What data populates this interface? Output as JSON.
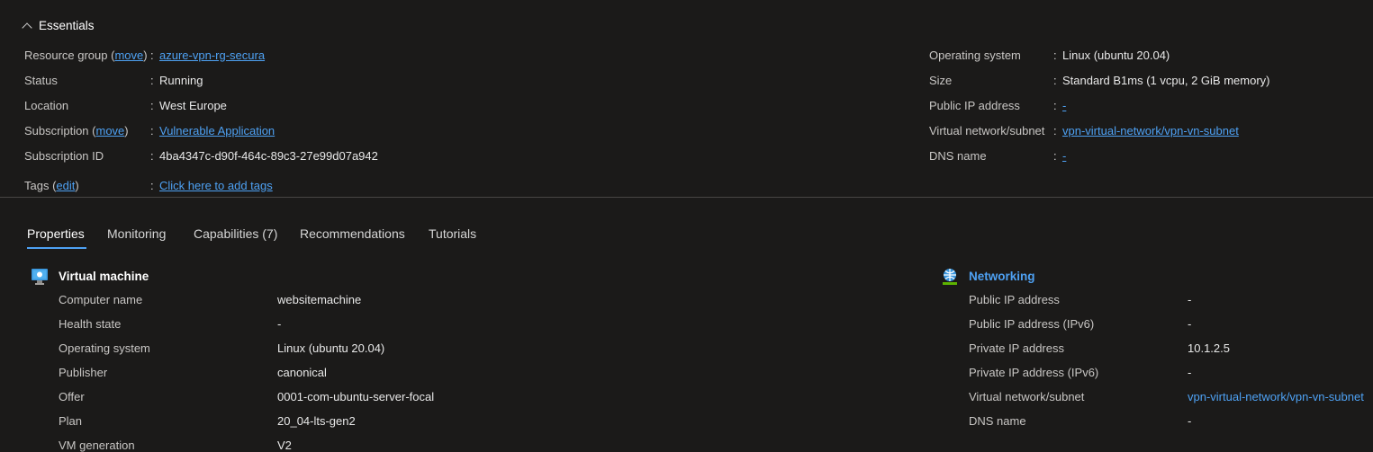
{
  "essentials": {
    "title": "Essentials",
    "left": [
      {
        "label": "Resource group",
        "action": "move",
        "value": "azure-vpn-rg-secura",
        "link": true
      },
      {
        "label": "Status",
        "value": "Running",
        "link": false
      },
      {
        "label": "Location",
        "value": "West Europe",
        "link": false
      },
      {
        "label": "Subscription",
        "action": "move",
        "value": "Vulnerable Application",
        "link": true
      },
      {
        "label": "Subscription ID",
        "value": "4ba4347c-d90f-464c-89c3-27e99d07a942",
        "link": false
      }
    ],
    "tags": {
      "label": "Tags",
      "action": "edit",
      "value": "Click here to add tags"
    },
    "right": [
      {
        "label": "Operating system",
        "value": "Linux (ubuntu 20.04)",
        "link": false
      },
      {
        "label": "Size",
        "value": "Standard B1ms (1 vcpu, 2 GiB memory)",
        "link": false
      },
      {
        "label": "Public IP address",
        "value": "-",
        "link": true
      },
      {
        "label": "Virtual network/subnet",
        "value": "vpn-virtual-network/vpn-vn-subnet",
        "link": true
      },
      {
        "label": "DNS name",
        "value": "-",
        "link": true
      }
    ]
  },
  "tabs": [
    "Properties",
    "Monitoring",
    "Capabilities (7)",
    "Recommendations",
    "Tutorials"
  ],
  "active_tab": "Properties",
  "virtual_machine": {
    "title": "Virtual machine",
    "rows": [
      {
        "label": "Computer name",
        "value": "websitemachine"
      },
      {
        "label": "Health state",
        "value": "-"
      },
      {
        "label": "Operating system",
        "value": "Linux (ubuntu 20.04)"
      },
      {
        "label": "Publisher",
        "value": "canonical"
      },
      {
        "label": "Offer",
        "value": "0001-com-ubuntu-server-focal"
      },
      {
        "label": "Plan",
        "value": "20_04-lts-gen2"
      },
      {
        "label": "VM generation",
        "value": "V2"
      }
    ]
  },
  "networking": {
    "title": "Networking",
    "rows": [
      {
        "label": "Public IP address",
        "value": "-"
      },
      {
        "label": "Public IP address (IPv6)",
        "value": "-"
      },
      {
        "label": "Private IP address",
        "value": "10.1.2.5"
      },
      {
        "label": "Private IP address (IPv6)",
        "value": "-"
      },
      {
        "label": "Virtual network/subnet",
        "value": "vpn-virtual-network/vpn-vn-subnet",
        "link": true
      },
      {
        "label": "DNS name",
        "value": "-"
      }
    ]
  },
  "colors": {
    "background": "#1b1a19",
    "link": "#4ea1f3",
    "divider": "#484644"
  }
}
